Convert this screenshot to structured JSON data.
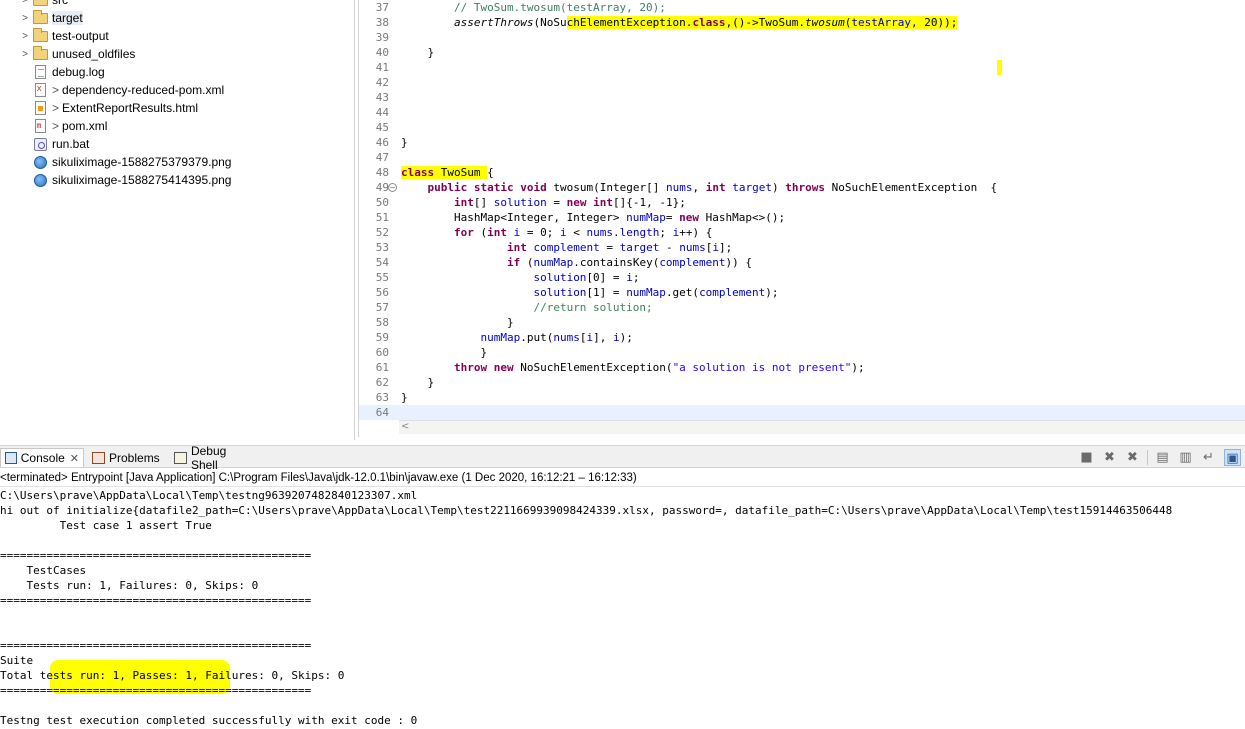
{
  "explorer": {
    "items": [
      {
        "label": "src",
        "icon": "folder-icon",
        "twisty": ">",
        "overlay": ""
      },
      {
        "label": "target",
        "icon": "folder-icon",
        "twisty": ">",
        "overlay": ""
      },
      {
        "label": "test-output",
        "icon": "folder-icon",
        "twisty": ">",
        "overlay": ""
      },
      {
        "label": "unused_oldfiles",
        "icon": "folder-icon",
        "twisty": ">",
        "overlay": ""
      },
      {
        "label": "debug.log",
        "icon": "file-icon",
        "twisty": "",
        "overlay": ""
      },
      {
        "label": "dependency-reduced-pom.xml",
        "icon": "xml-file-icon",
        "twisty": "",
        "overlay": ">"
      },
      {
        "label": "ExtentReportResults.html",
        "icon": "html-file-icon",
        "twisty": "",
        "overlay": ">"
      },
      {
        "label": "pom.xml",
        "icon": "pom-file-icon",
        "twisty": "",
        "overlay": ">"
      },
      {
        "label": "run.bat",
        "icon": "bat-file-icon",
        "twisty": "",
        "overlay": ""
      },
      {
        "label": "sikuliximage-1588275379379.png",
        "icon": "image-file-icon",
        "twisty": "",
        "overlay": ""
      },
      {
        "label": "sikuliximage-1588275414395.png",
        "icon": "image-file-icon",
        "twisty": "",
        "overlay": ""
      }
    ]
  },
  "editor": {
    "lines": [
      {
        "num": "37",
        "fold": "",
        "segs": [
          {
            "t": "        "
          },
          {
            "t": "// TwoSum.twosum(testArray, 20);",
            "c": "cm"
          }
        ]
      },
      {
        "num": "38",
        "fold": "",
        "segs": [
          {
            "t": "        "
          },
          {
            "t": "assertThrows",
            "c": "it"
          },
          {
            "t": "(NoSu"
          },
          {
            "t": "chElementException.",
            "c": "hl"
          },
          {
            "t": "class",
            "c": "kw hl"
          },
          {
            "t": ",()->TwoSum.",
            "c": "hl"
          },
          {
            "t": "twosum",
            "c": "it hl"
          },
          {
            "t": "(",
            "c": "hl"
          },
          {
            "t": "testArray",
            "c": "fld hl"
          },
          {
            "t": ", 20));",
            "c": "hl"
          }
        ]
      },
      {
        "num": "39",
        "fold": "",
        "segs": [
          {
            "t": ""
          }
        ]
      },
      {
        "num": "40",
        "fold": "",
        "segs": [
          {
            "t": "    }"
          }
        ]
      },
      {
        "num": "41",
        "fold": "",
        "segs": [
          {
            "t": ""
          }
        ]
      },
      {
        "num": "42",
        "fold": "",
        "segs": [
          {
            "t": ""
          }
        ]
      },
      {
        "num": "43",
        "fold": "",
        "segs": [
          {
            "t": ""
          }
        ]
      },
      {
        "num": "44",
        "fold": "",
        "segs": [
          {
            "t": ""
          }
        ]
      },
      {
        "num": "45",
        "fold": "",
        "segs": [
          {
            "t": ""
          }
        ]
      },
      {
        "num": "46",
        "fold": "",
        "segs": [
          {
            "t": "}"
          }
        ]
      },
      {
        "num": "47",
        "fold": "",
        "segs": [
          {
            "t": ""
          }
        ]
      },
      {
        "num": "48",
        "fold": "",
        "segs": [
          {
            "t": "class",
            "c": "kw hl"
          },
          {
            "t": " TwoSum ",
            "c": "hl"
          },
          {
            "t": "{"
          }
        ]
      },
      {
        "num": "49",
        "fold": "⊖",
        "segs": [
          {
            "t": "    "
          },
          {
            "t": "public",
            "c": "kw"
          },
          {
            "t": " "
          },
          {
            "t": "static",
            "c": "kw"
          },
          {
            "t": " "
          },
          {
            "t": "void",
            "c": "kw"
          },
          {
            "t": " twosum(Integer[] "
          },
          {
            "t": "nums",
            "c": "fld"
          },
          {
            "t": ", "
          },
          {
            "t": "int",
            "c": "kw"
          },
          {
            "t": " "
          },
          {
            "t": "target",
            "c": "fld"
          },
          {
            "t": ") "
          },
          {
            "t": "throws",
            "c": "kw"
          },
          {
            "t": " NoSuchElementException  {"
          }
        ]
      },
      {
        "num": "50",
        "fold": "",
        "segs": [
          {
            "t": "        "
          },
          {
            "t": "int",
            "c": "kw"
          },
          {
            "t": "[] "
          },
          {
            "t": "solution",
            "c": "fld"
          },
          {
            "t": " = "
          },
          {
            "t": "new",
            "c": "kw"
          },
          {
            "t": " "
          },
          {
            "t": "int",
            "c": "kw"
          },
          {
            "t": "[]{-1, -1};"
          }
        ]
      },
      {
        "num": "51",
        "fold": "",
        "segs": [
          {
            "t": "        HashMap<Integer, Integer> "
          },
          {
            "t": "numMap",
            "c": "fld"
          },
          {
            "t": "= "
          },
          {
            "t": "new",
            "c": "kw"
          },
          {
            "t": " HashMap<>();"
          }
        ]
      },
      {
        "num": "52",
        "fold": "",
        "segs": [
          {
            "t": "        "
          },
          {
            "t": "for",
            "c": "kw"
          },
          {
            "t": " ("
          },
          {
            "t": "int",
            "c": "kw"
          },
          {
            "t": " "
          },
          {
            "t": "i",
            "c": "fld"
          },
          {
            "t": " = 0; "
          },
          {
            "t": "i",
            "c": "fld"
          },
          {
            "t": " < "
          },
          {
            "t": "nums",
            "c": "fld"
          },
          {
            "t": "."
          },
          {
            "t": "length",
            "c": "fld"
          },
          {
            "t": "; "
          },
          {
            "t": "i",
            "c": "fld"
          },
          {
            "t": "++) {"
          }
        ]
      },
      {
        "num": "53",
        "fold": "",
        "segs": [
          {
            "t": "                "
          },
          {
            "t": "int",
            "c": "kw"
          },
          {
            "t": " "
          },
          {
            "t": "complement",
            "c": "fld"
          },
          {
            "t": " = "
          },
          {
            "t": "target",
            "c": "fld"
          },
          {
            "t": " - "
          },
          {
            "t": "nums",
            "c": "fld"
          },
          {
            "t": "["
          },
          {
            "t": "i",
            "c": "fld"
          },
          {
            "t": "];"
          }
        ]
      },
      {
        "num": "54",
        "fold": "",
        "segs": [
          {
            "t": "                "
          },
          {
            "t": "if",
            "c": "kw"
          },
          {
            "t": " ("
          },
          {
            "t": "numMap",
            "c": "fld"
          },
          {
            "t": ".containsKey("
          },
          {
            "t": "complement",
            "c": "fld"
          },
          {
            "t": ")) {"
          }
        ]
      },
      {
        "num": "55",
        "fold": "",
        "segs": [
          {
            "t": "                    "
          },
          {
            "t": "solution",
            "c": "fld"
          },
          {
            "t": "[0] = "
          },
          {
            "t": "i",
            "c": "fld"
          },
          {
            "t": ";"
          }
        ]
      },
      {
        "num": "56",
        "fold": "",
        "segs": [
          {
            "t": "                    "
          },
          {
            "t": "solution",
            "c": "fld"
          },
          {
            "t": "[1] = "
          },
          {
            "t": "numMap",
            "c": "fld"
          },
          {
            "t": ".get("
          },
          {
            "t": "complement",
            "c": "fld"
          },
          {
            "t": ");"
          }
        ]
      },
      {
        "num": "57",
        "fold": "",
        "segs": [
          {
            "t": "                    "
          },
          {
            "t": "//return solution;",
            "c": "cm"
          }
        ]
      },
      {
        "num": "58",
        "fold": "",
        "segs": [
          {
            "t": "                }"
          }
        ]
      },
      {
        "num": "59",
        "fold": "",
        "segs": [
          {
            "t": "            "
          },
          {
            "t": "numMap",
            "c": "fld"
          },
          {
            "t": ".put("
          },
          {
            "t": "nums",
            "c": "fld"
          },
          {
            "t": "["
          },
          {
            "t": "i",
            "c": "fld"
          },
          {
            "t": "], "
          },
          {
            "t": "i",
            "c": "fld"
          },
          {
            "t": ");"
          }
        ]
      },
      {
        "num": "60",
        "fold": "",
        "segs": [
          {
            "t": "            }"
          }
        ]
      },
      {
        "num": "61",
        "fold": "",
        "segs": [
          {
            "t": "        "
          },
          {
            "t": "throw",
            "c": "kw"
          },
          {
            "t": " "
          },
          {
            "t": "new",
            "c": "kw"
          },
          {
            "t": " NoSuchElementException("
          },
          {
            "t": "\"a solution is not present\"",
            "c": "st"
          },
          {
            "t": ");"
          }
        ]
      },
      {
        "num": "62",
        "fold": "",
        "segs": [
          {
            "t": "    }"
          }
        ]
      },
      {
        "num": "63",
        "fold": "",
        "segs": [
          {
            "t": "}"
          }
        ]
      },
      {
        "num": "64",
        "fold": "",
        "segs": [
          {
            "t": ""
          }
        ],
        "current": true
      }
    ]
  },
  "console": {
    "tabs": [
      {
        "label": "Console",
        "icon": "console-icon",
        "closable": true,
        "active": true
      },
      {
        "label": "Problems",
        "icon": "problems-icon",
        "closable": false,
        "active": false
      },
      {
        "label": "Debug Shell",
        "icon": "debug-shell-icon",
        "closable": false,
        "active": false
      }
    ],
    "toolbar": [
      {
        "name": "terminate-icon",
        "glyph": "■",
        "active": false
      },
      {
        "name": "remove-launch-icon",
        "glyph": "✖",
        "active": false
      },
      {
        "name": "remove-all-terminated-icon",
        "glyph": "✖",
        "active": false
      },
      {
        "name": "clear-console-icon",
        "glyph": "▤",
        "active": false
      },
      {
        "name": "scroll-lock-icon",
        "glyph": "▥",
        "active": false
      },
      {
        "name": "word-wrap-icon",
        "glyph": "↵",
        "active": false
      },
      {
        "name": "pin-console-icon",
        "glyph": "▣",
        "active": true
      }
    ],
    "status": "<terminated> Entrypoint [Java Application] C:\\Program Files\\Java\\jdk-12.0.1\\bin\\javaw.exe  (1 Dec 2020, 16:12:21 – 16:12:33)",
    "lines": [
      "C:\\Users\\prave\\AppData\\Local\\Temp\\testng9639207482840123307.xml",
      "hi out of initialize{datafile2_path=C:\\Users\\prave\\AppData\\Local\\Temp\\test2211669939098424339.xlsx, password=, datafile_path=C:\\Users\\prave\\AppData\\Local\\Temp\\test15914463506448",
      "         Test case 1 assert True",
      "",
      "===============================================",
      "    TestCases",
      "    Tests run: 1, Failures: 0, Skips: 0",
      "===============================================",
      "",
      "",
      "===============================================",
      "Suite",
      "Total tests run: 1, Passes: 1, Failures: 0, Skips: 0",
      "===============================================",
      "",
      "Testng test execution completed successfully with exit code : 0"
    ]
  }
}
